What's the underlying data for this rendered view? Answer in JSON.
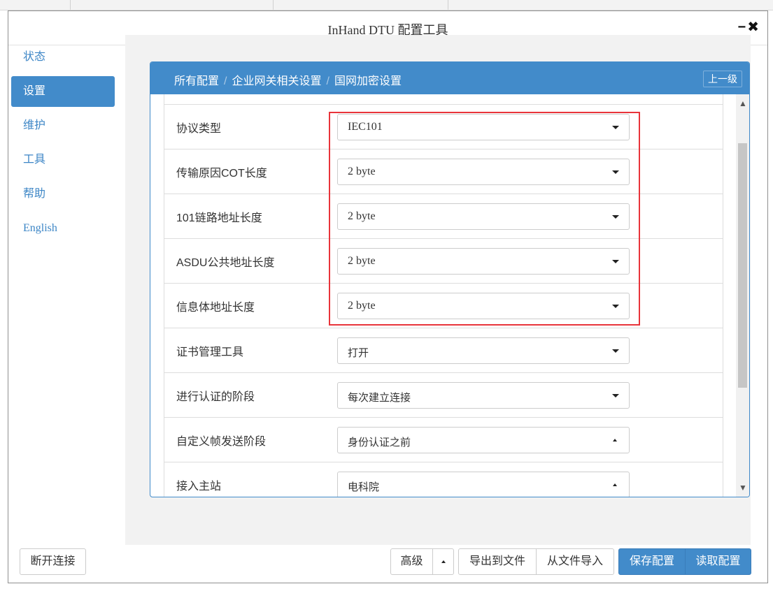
{
  "window": {
    "title": "InHand DTU 配置工具",
    "minimize_label": "−",
    "close_label": "✖"
  },
  "sidebar": {
    "items": [
      {
        "label": "状态"
      },
      {
        "label": "设置"
      },
      {
        "label": "维护"
      },
      {
        "label": "工具"
      },
      {
        "label": "帮助"
      },
      {
        "label": "English"
      }
    ],
    "active": "设置",
    "disconnect_label": "断开连接"
  },
  "panel": {
    "breadcrumb": [
      "所有配置",
      "企业网关相关设置",
      "国网加密设置"
    ],
    "breadcrumb_sep": "/",
    "up_label": "上一级",
    "rows": [
      {
        "label": "协议类型",
        "value": "IEC101"
      },
      {
        "label": "传输原因COT长度",
        "value": "2 byte"
      },
      {
        "label": "101链路地址长度",
        "value": "2 byte"
      },
      {
        "label": "ASDU公共地址长度",
        "value": "2 byte"
      },
      {
        "label": "信息体地址长度",
        "value": "2 byte"
      },
      {
        "label": "证书管理工具",
        "value": "打开"
      },
      {
        "label": "进行认证的阶段",
        "value": "每次建立连接"
      },
      {
        "label": "自定义帧发送阶段",
        "value": "身份认证之前"
      },
      {
        "label": "接入主站",
        "value": "电科院"
      }
    ]
  },
  "footer": {
    "advanced_label": "高级",
    "export_label": "导出到文件",
    "import_label": "从文件导入",
    "save_label": "保存配置",
    "read_label": "读取配置"
  },
  "colors": {
    "accent": "#428bca",
    "highlight_border": "#e8343a"
  }
}
